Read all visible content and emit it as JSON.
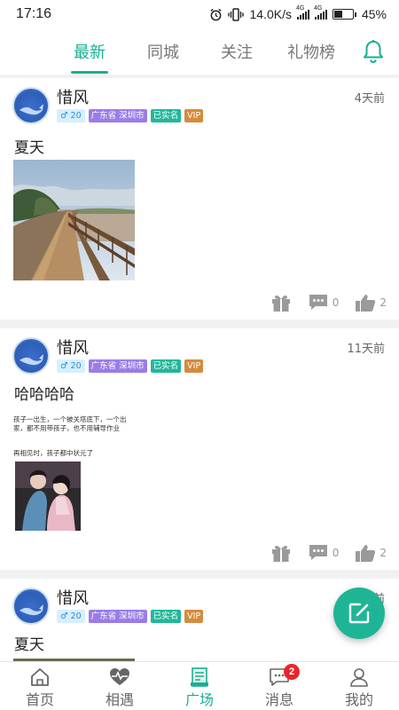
{
  "status_bar": {
    "time": "17:16",
    "net_speed": "14.0K/s",
    "signal_1_label": "4G",
    "signal_2_label": "4G",
    "battery": "45%",
    "battery_level": 0.45
  },
  "tabs": [
    {
      "label": "最新",
      "active": true
    },
    {
      "label": "同城",
      "active": false
    },
    {
      "label": "关注",
      "active": false
    },
    {
      "label": "礼物榜",
      "active": false
    }
  ],
  "posts": [
    {
      "username": "惜风",
      "time": "4天前",
      "gender_age": "♂ 20",
      "location": "广东省 深圳市",
      "verified": "已实名",
      "vip": "VIP",
      "text": "夏天",
      "image": "boardwalk-photo",
      "comments": "0",
      "likes": "2"
    },
    {
      "username": "惜风",
      "time": "11天前",
      "gender_age": "♂ 20",
      "location": "广东省 深圳市",
      "verified": "已实名",
      "vip": "VIP",
      "text": "哈哈哈哈",
      "image_caption_1": "孩子一出生，一个被关塔底下，一个出家，都不用带孩子，也不用辅导作业",
      "image_caption_2": "再相见时，孩子都中状元了",
      "image": "drama-photo",
      "comments": "0",
      "likes": "2"
    },
    {
      "username": "惜风",
      "time": "前",
      "gender_age": "♂ 20",
      "location": "广东省 深圳市",
      "verified": "已实名",
      "vip": "VIP",
      "text": "夏天"
    }
  ],
  "bottom_nav": [
    {
      "label": "首页",
      "icon": "home-icon",
      "active": false
    },
    {
      "label": "相遇",
      "icon": "heart-pulse-icon",
      "active": false
    },
    {
      "label": "广场",
      "icon": "square-feed-icon",
      "active": true
    },
    {
      "label": "消息",
      "icon": "message-icon",
      "active": false,
      "badge": "2"
    },
    {
      "label": "我的",
      "icon": "profile-icon",
      "active": false
    }
  ],
  "colors": {
    "accent": "#1aae91",
    "badge_location": "#9a7ce8",
    "badge_verified": "#21b89a",
    "badge_vip": "#d48b3d",
    "notification": "#e8262a"
  }
}
